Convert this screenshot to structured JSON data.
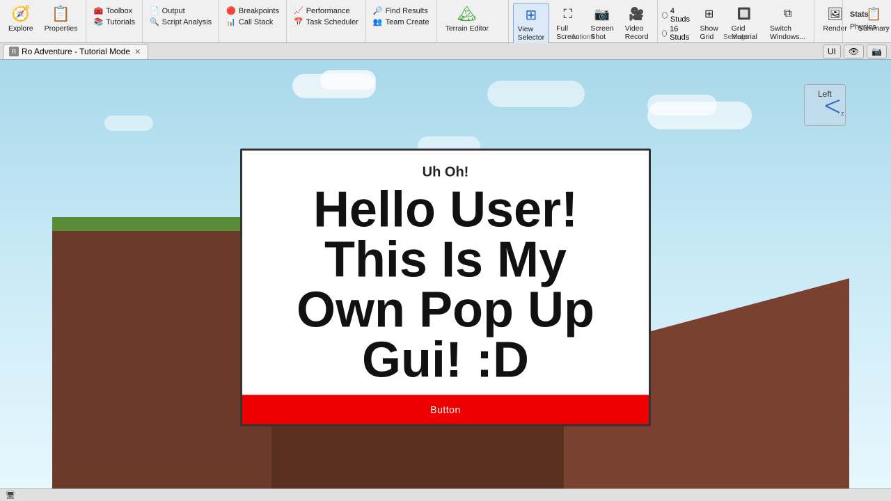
{
  "toolbar": {
    "sections": [
      {
        "name": "nav",
        "items": [
          {
            "id": "explore",
            "label": "Explore",
            "icon": "🧭",
            "large": true
          },
          {
            "id": "properties",
            "label": "Properties",
            "icon": "📋",
            "large": true
          }
        ],
        "bottom_label": ""
      },
      {
        "name": "tools",
        "items": [
          {
            "id": "toolbox",
            "label": "Toolbox",
            "icon": "🧰",
            "small": true
          },
          {
            "id": "tutorials",
            "label": "Tutorials",
            "icon": "📚",
            "small": true
          }
        ],
        "bottom_label": ""
      },
      {
        "name": "test",
        "items": [
          {
            "id": "output",
            "label": "Output",
            "icon": "📄",
            "small": true
          },
          {
            "id": "script-analysis",
            "label": "Script Analysis",
            "icon": "🔍",
            "small": true
          }
        ],
        "bottom_label": ""
      },
      {
        "name": "debug",
        "items": [
          {
            "id": "breakpoints",
            "label": "Breakpoints",
            "icon": "🔴",
            "small": true
          },
          {
            "id": "call-stack",
            "label": "Call Stack",
            "icon": "📊",
            "small": true
          }
        ],
        "bottom_label": ""
      },
      {
        "name": "performance",
        "items": [
          {
            "id": "performance",
            "label": "Performance",
            "icon": "📈",
            "small": true
          },
          {
            "id": "task-scheduler",
            "label": "Task Scheduler",
            "icon": "📅",
            "small": true
          }
        ],
        "bottom_label": ""
      },
      {
        "name": "find",
        "items": [
          {
            "id": "find-results",
            "label": "Find Results",
            "icon": "🔎",
            "small": true
          },
          {
            "id": "team-create",
            "label": "Team Create",
            "icon": "👥",
            "small": true
          }
        ],
        "bottom_label": ""
      },
      {
        "name": "terrain",
        "items": [
          {
            "id": "terrain-editor",
            "label": "Terrain Editor",
            "icon": "🏔",
            "large": true
          }
        ],
        "bottom_label": ""
      },
      {
        "name": "view",
        "items": [
          {
            "id": "view-selector",
            "label": "View\nSelector",
            "icon": "⊞",
            "large": true,
            "active": true
          },
          {
            "id": "full-screen",
            "label": "Full\nScreen",
            "icon": "⛶",
            "large": true
          },
          {
            "id": "screen-shot",
            "label": "Screen\nShot",
            "icon": "📷",
            "large": true
          },
          {
            "id": "video-record",
            "label": "Video\nRecord",
            "icon": "🎥",
            "large": true
          }
        ],
        "bottom_label": "Actions"
      },
      {
        "name": "studs",
        "radio": [
          {
            "id": "4-studs",
            "label": "4 Studs",
            "active": false
          },
          {
            "id": "16-studs",
            "label": "16 Studs",
            "active": false
          }
        ],
        "items": [
          {
            "id": "show-grid",
            "label": "Show\nGrid",
            "icon": "⊞",
            "large": true
          },
          {
            "id": "grid-material",
            "label": "Grid\nMaterial",
            "icon": "🔲",
            "large": true
          },
          {
            "id": "switch-windows",
            "label": "Switch\nWindows...",
            "icon": "⧉",
            "large": true
          }
        ],
        "bottom_label": "Settings"
      },
      {
        "name": "render",
        "items": [
          {
            "id": "render",
            "label": "Render",
            "icon": "🖼",
            "large": true
          },
          {
            "id": "summary",
            "label": "Summary",
            "icon": "📋",
            "large": true
          }
        ],
        "bottom_label": ""
      },
      {
        "name": "physics-section",
        "items": [
          {
            "id": "physics",
            "label": "Physics",
            "icon": "⚙",
            "large": true
          }
        ],
        "bottom_label": ""
      }
    ]
  },
  "tabbar": {
    "tabs": [
      {
        "id": "ro-adventure",
        "label": "Ro Adventure - Tutorial Mode",
        "closable": true
      }
    ]
  },
  "top_right": {
    "ui_label": "UI",
    "eye_icon": "👁",
    "camera_icon": "📷"
  },
  "compass": {
    "label": "Left"
  },
  "popup": {
    "subtitle": "Uh Oh!",
    "title": "Hello User! This Is My Own Pop Up Gui! :D",
    "button_label": "Button"
  },
  "bottombar": {
    "icon": "🖥",
    "text": ""
  }
}
